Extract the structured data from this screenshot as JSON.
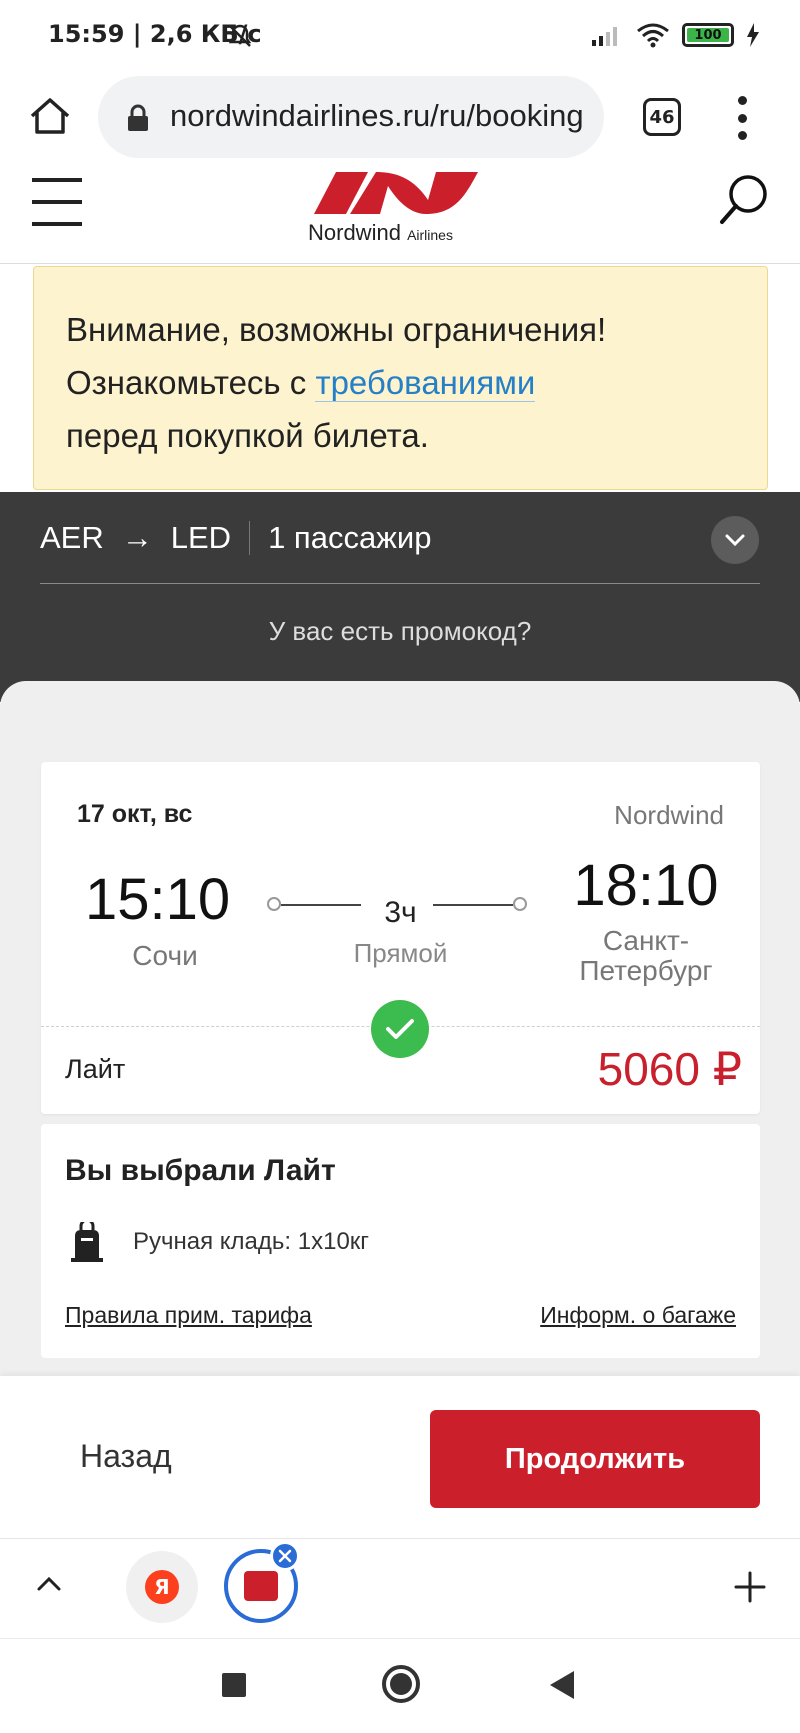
{
  "status_bar": {
    "time_speed": "15:59 | 2,6 КБ/с",
    "battery": "100",
    "battery_level": 1.0
  },
  "browser": {
    "url": "nordwindairlines.ru/ru/booking",
    "tab_count": "46",
    "icons": [
      "home-icon",
      "lock-icon",
      "tabs-icon",
      "more-icon"
    ]
  },
  "site_header": {
    "logo_text": "Nordwind",
    "logo_sub": "Airlines",
    "icons": [
      "hamburger-icon",
      "search-icon"
    ],
    "brand_color": "#cc1f2c"
  },
  "notice": {
    "line1": "Внимание, возможны ограничения!",
    "line2_prefix": "Ознакомьтесь с ",
    "link": "требованиями",
    "line3": "перед покупкой билета."
  },
  "summary": {
    "from": "AER",
    "arrow": "→",
    "to": "LED",
    "passengers": "1 пассажир",
    "promo": "У вас есть промокод?"
  },
  "flight": {
    "date": "17 окт, вс",
    "airline": "Nordwind",
    "dep_time": "15:10",
    "dep_city": "Сочи",
    "arr_time": "18:10",
    "arr_city_1": "Санкт-",
    "arr_city_2": "Петербург",
    "duration": "3ч",
    "stops": "Прямой",
    "fare": "Лайт",
    "price": "5060 ₽",
    "price_color": "#c8202d",
    "check_color": "#3cbb4e"
  },
  "tariff": {
    "title": "Вы выбрали Лайт",
    "baggage": "Ручная кладь: 1х10кг",
    "rules_link": "Правила прим. тарифа",
    "baggage_link": "Информ. о багаже"
  },
  "actions": {
    "back": "Назад",
    "continue": "Продолжить"
  },
  "tabstrip": {
    "yandex_letter": "Я"
  }
}
